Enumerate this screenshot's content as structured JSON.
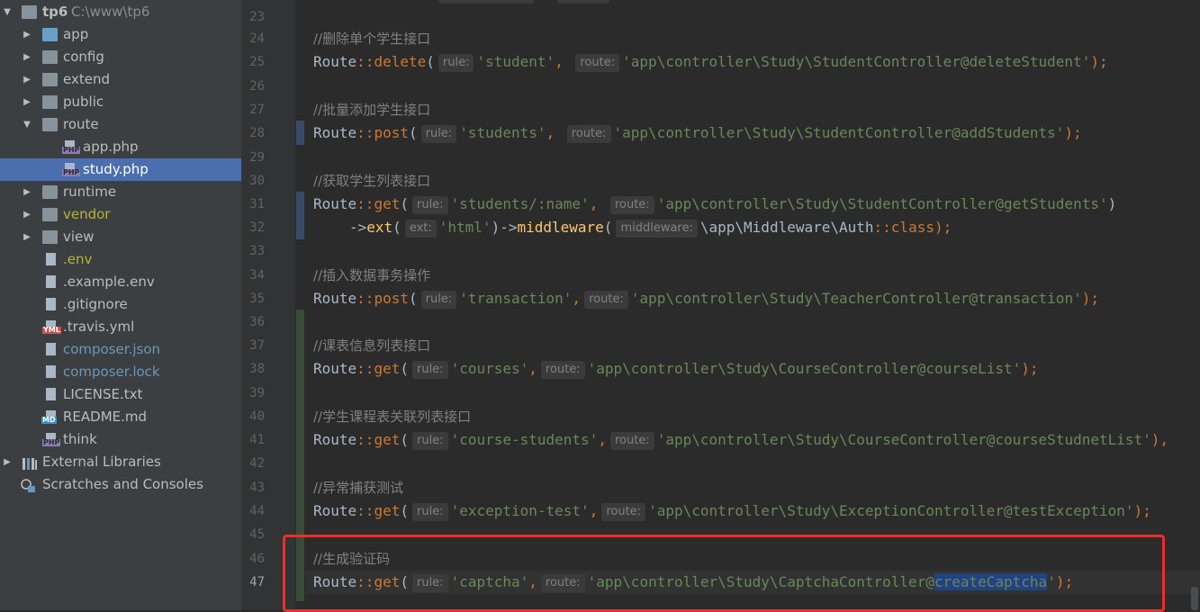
{
  "project_tree": {
    "root": {
      "name": "tp6",
      "path": "C:\\www\\tp6"
    },
    "items": [
      {
        "label": "app"
      },
      {
        "label": "config"
      },
      {
        "label": "extend"
      },
      {
        "label": "public"
      },
      {
        "label": "route"
      },
      {
        "label": "app.php"
      },
      {
        "label": "study.php"
      },
      {
        "label": "runtime"
      },
      {
        "label": "vendor"
      },
      {
        "label": "view"
      },
      {
        "label": ".env"
      },
      {
        "label": ".example.env"
      },
      {
        "label": ".gitignore"
      },
      {
        "label": ".travis.yml"
      },
      {
        "label": "composer.json"
      },
      {
        "label": "composer.lock"
      },
      {
        "label": "LICENSE.txt"
      },
      {
        "label": "README.md"
      },
      {
        "label": "think"
      }
    ],
    "external_libraries": "External Libraries",
    "scratches": "Scratches and Consoles",
    "icon_marks": {
      "php": "PHP",
      "yml": "YML",
      "md": "MD"
    },
    "colors": {
      "selected_bg": "#4b6eaf",
      "vendor_text": "#b5b533",
      "composer_text": "#6897bb"
    }
  },
  "editor": {
    "line_numbers": [
      "23",
      "24",
      "25",
      "26",
      "27",
      "28",
      "29",
      "30",
      "31",
      "32",
      "33",
      "34",
      "35",
      "36",
      "37",
      "38",
      "39",
      "40",
      "41",
      "42",
      "43",
      "44",
      "45",
      "46",
      "47"
    ],
    "comments": {
      "c24": "//删除单个学生接口",
      "c27": "//批量添加学生接口",
      "c30": "//获取学生列表接口",
      "c34": "//插入数据事务操作",
      "c37": "//课表信息列表接口",
      "c40": "//学生课程表关联列表接口",
      "c43": "//异常捕获测试",
      "c46": "//生成验证码"
    },
    "tokens": {
      "route": "Route",
      "dc": "::",
      "delete": "delete",
      "post": "post",
      "get": "get",
      "ext": "ext",
      "middleware": "middleware",
      "arrow": "->",
      "auth": "Auth",
      "class_kw": "class",
      "mw_ns": "\\app\\Middleware\\",
      "open": "(",
      "close": ")",
      "close_semi": ");",
      "close_comma": "),",
      "comma": ",",
      "comma_sp": ", "
    },
    "hints": {
      "rule": "rule:",
      "route": "route:",
      "ext": "ext:",
      "middleware": "middleware:"
    },
    "strings": {
      "s25a": "'student'",
      "s25b": "'app\\controller\\Study\\StudentController@deleteStudent'",
      "s28a": "'students'",
      "s28b": "'app\\controller\\Study\\StudentController@addStudents'",
      "s31a": "'students/:name'",
      "s31b": "'app\\controller\\Study\\StudentController@getStudents'",
      "s32a": "'html'",
      "s35a": "'transaction'",
      "s35b": "'app\\controller\\Study\\TeacherController@transaction'",
      "s38a": "'courses'",
      "s38b": "'app\\controller\\Study\\CourseController@courseList'",
      "s41a": "'course-students'",
      "s41b": "'app\\controller\\Study\\CourseController@courseStudnetList'",
      "s44a": "'exception-test'",
      "s44b": "'app\\controller\\Study\\ExceptionController@testException'",
      "s47a": "'captcha'",
      "s47b_pre": "'app\\controller\\Study\\CaptchaController@",
      "s47b_sel": "createCaptcha",
      "s47b_end": "'"
    },
    "colors": {
      "keyword": "#cc7832",
      "string": "#6a8759",
      "function": "#ffc66d",
      "comment": "#808080",
      "highlight_box": "#e8302c"
    }
  }
}
